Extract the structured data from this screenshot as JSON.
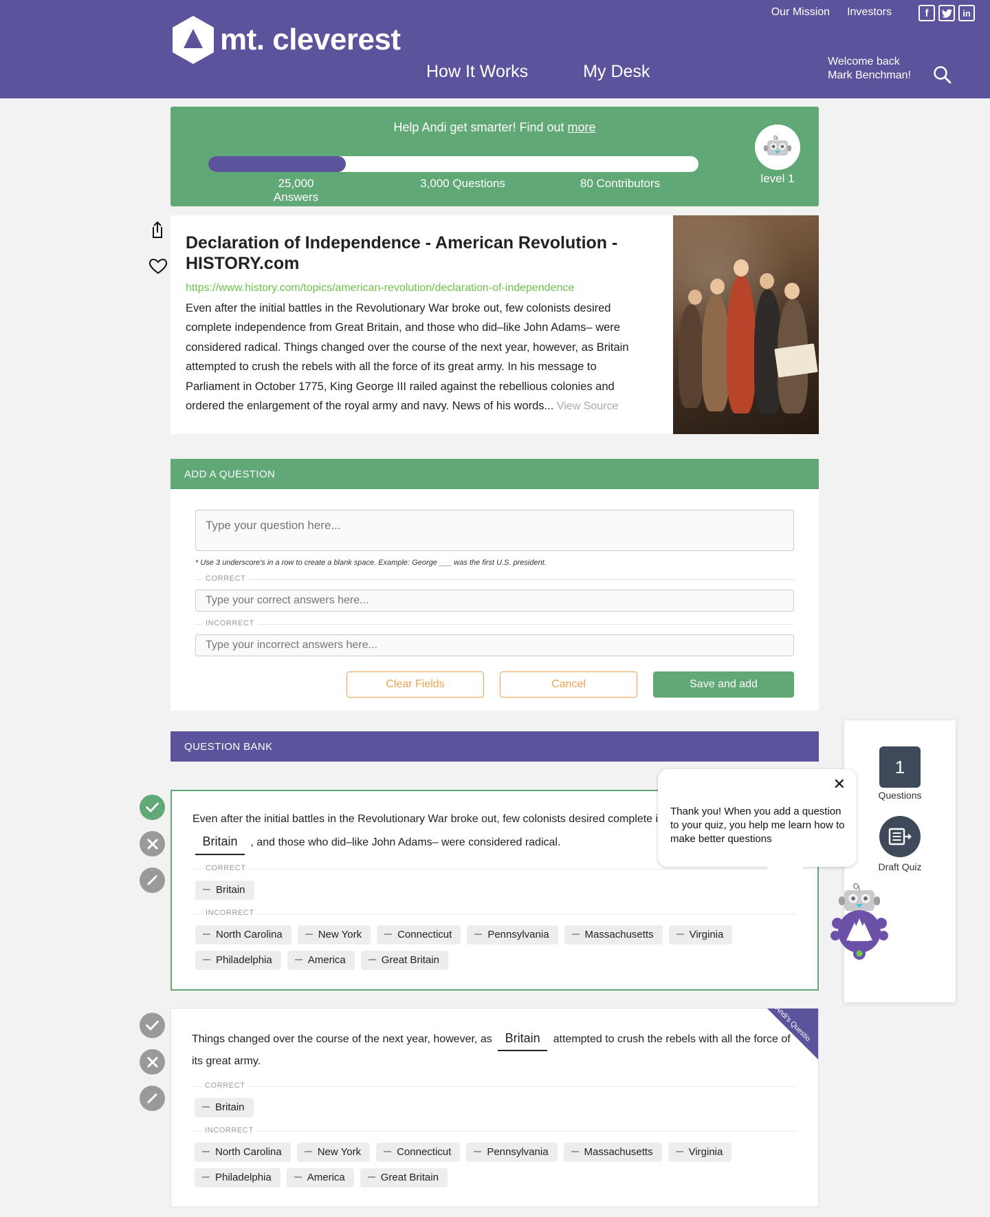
{
  "brand": {
    "name": "mt. cleverest",
    "logo_icon": "mountain-logo-icon"
  },
  "header": {
    "top_links": [
      {
        "label": "Our Mission",
        "name": "our-mission"
      },
      {
        "label": "Investors",
        "name": "investors"
      }
    ],
    "social": [
      {
        "label": "f",
        "name": "facebook-icon"
      },
      {
        "label": "t",
        "name": "twitter-icon"
      },
      {
        "label": "in",
        "name": "linkedin-icon"
      }
    ],
    "nav": [
      {
        "label": "How It Works",
        "name": "how-it-works"
      },
      {
        "label": "My Desk",
        "name": "my-desk"
      }
    ],
    "welcome_line1": "Welcome back",
    "welcome_line2": "Mark Benchman!",
    "search_icon": "search-icon",
    "bg_color": "#5b539b"
  },
  "progress": {
    "headline_prefix": "Help  Andi get smarter! Find out ",
    "headline_link": "more",
    "fill_percent": 28,
    "stats": [
      {
        "value": "25,000",
        "unit": "Answers"
      },
      {
        "value": "3,000 Questions",
        "unit": ""
      },
      {
        "value": "80 Contributors",
        "unit": ""
      }
    ],
    "level_label": "level 1",
    "avatar_icon": "robot-avatar-icon",
    "bg_color": "#60a875"
  },
  "article": {
    "tools": [
      {
        "name": "share-icon"
      },
      {
        "name": "heart-icon"
      }
    ],
    "title": "Declaration of Independence - American Revolution - HISTORY.com",
    "url": "https://www.history.com/topics/american-revolution/declaration-of-independence",
    "snippet": "Even after the initial battles in the Revolutionary War broke out, few colonists desired complete independence from Great Britain, and those who did–like John Adams– were considered radical. Things changed over the course of the next year, however, as Britain attempted to crush the rebels with all the force of its great army. In his message to Parliament in October 1775, King George III railed against the rebellious colonies and ordered the enlargement of the royal army and navy. News of his words...",
    "view_source": "View Source",
    "url_color": "#6cc24a"
  },
  "add_question": {
    "panel_title": "ADD A QUESTION",
    "question_placeholder": "Type your question here...",
    "question_value": "",
    "hint": "* Use 3 underscore's in a row to create a blank space. Example: George ___ was the first U.S. president.",
    "correct_legend": "CORRECT",
    "correct_placeholder": "Type your correct answers here...",
    "correct_value": "",
    "incorrect_legend": "INCORRECT",
    "incorrect_placeholder": "Type your incorrect answers here...",
    "incorrect_value": "",
    "buttons": {
      "clear": "Clear Fields",
      "cancel": "Cancel",
      "save": "Save and add"
    }
  },
  "question_bank": {
    "panel_title": "QUESTION BANK",
    "questions": [
      {
        "text_before": "Even after the initial battles in the Revolutionary War broke out, few colonists desired complete independence from Great",
        "blank": "Britain",
        "text_after": ", and those who did–like John Adams– were considered radical.",
        "correct_legend": "CORRECT",
        "correct": [
          "Britain"
        ],
        "incorrect_legend": "INCORRECT",
        "incorrect": [
          "North Carolina",
          "New York",
          "Connecticut",
          "Pennsylvania",
          "Massachusetts",
          "Virginia",
          "Philadelphia",
          "America",
          "Great Britain"
        ],
        "state": "approved",
        "ribbon": ""
      },
      {
        "text_before": "Things changed over the course of the next year, however, as",
        "blank": "Britain",
        "text_after": "attempted to crush the rebels with all the force of its great army.",
        "correct_legend": "CORRECT",
        "correct": [
          "Britain"
        ],
        "incorrect_legend": "INCORRECT",
        "incorrect": [
          "North Carolina",
          "New York",
          "Connecticut",
          "Pennsylvania",
          "Massachusetts",
          "Virginia",
          "Philadelphia",
          "America",
          "Great Britain"
        ],
        "state": "neutral",
        "ribbon": "Andi's Questio"
      }
    ],
    "row_actions": [
      {
        "name": "approve-icon",
        "glyph": "✓"
      },
      {
        "name": "reject-icon",
        "glyph": "✕"
      },
      {
        "name": "edit-icon",
        "glyph": "✎"
      }
    ]
  },
  "side_panel": {
    "question_count": "1",
    "question_count_label": "Questions",
    "draft_label": "Draft Quiz",
    "draft_icon": "document-arrow-icon"
  },
  "bubble": {
    "close_icon": "close-icon",
    "text": "Thank you! When you add a question to your quiz, you help me learn how to make better questions",
    "mascot_icon": "andi-robot-mascot-icon"
  }
}
